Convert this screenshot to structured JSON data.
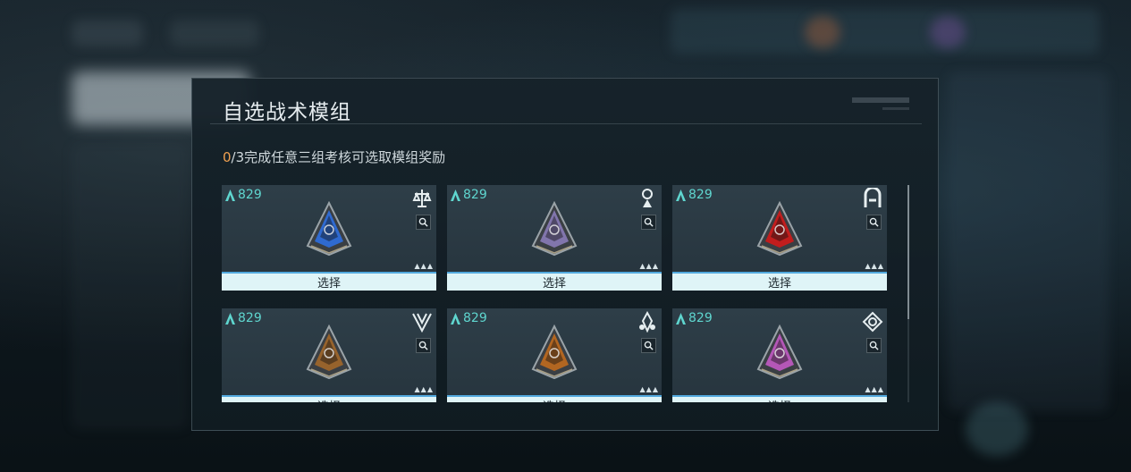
{
  "dialog": {
    "title": "自选战术模组",
    "progress": {
      "current": "0",
      "rest": "/3完成任意三组考核可选取模组奖励"
    }
  },
  "modules": [
    {
      "score": "829",
      "type_icon": "balance-icon",
      "gem_color": "#2f6fe0",
      "rarity": "▲▲▲",
      "select_label": "选择"
    },
    {
      "score": "829",
      "type_icon": "tower-icon",
      "gem_color": "#8a7bb8",
      "rarity": "▲▲▲",
      "select_label": "选择"
    },
    {
      "score": "829",
      "type_icon": "shield-a-icon",
      "gem_color": "#d21a1a",
      "rarity": "▲▲▲",
      "select_label": "选择"
    },
    {
      "score": "829",
      "type_icon": "chevron-emblem-icon",
      "gem_color": "#a2672a",
      "rarity": "▲▲▲",
      "select_label": "选择"
    },
    {
      "score": "829",
      "type_icon": "flame-icon",
      "gem_color": "#c06a1e",
      "rarity": "▲▲▲",
      "select_label": "选择"
    },
    {
      "score": "829",
      "type_icon": "spiral-icon",
      "gem_color": "#c25ac4",
      "rarity": "▲▲▲",
      "select_label": "选择"
    }
  ],
  "colors": {
    "score": "#5fd6cf",
    "progress_current": "#f0a050",
    "select_button_bg": "#dff4f7",
    "select_button_border": "#52a9de"
  }
}
